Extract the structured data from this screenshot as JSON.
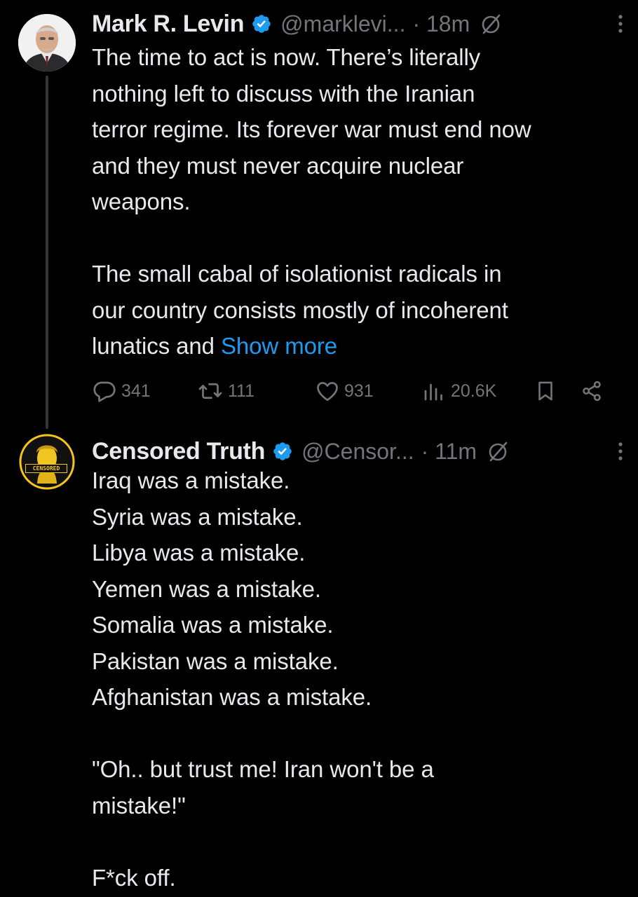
{
  "tweets": [
    {
      "name": "Mark R. Levin",
      "handle": "@marklevi...",
      "time": "· 18m",
      "lines": [
        "The time to act is now. There’s literally",
        "nothing left to discuss with the Iranian",
        "terror regime. Its forever war must end now",
        "and they must never acquire nuclear",
        "weapons.",
        "",
        "The small cabal of isolationist radicals in",
        "our country consists mostly of incoherent",
        "lunatics and "
      ],
      "show_more": "Show more",
      "stats": {
        "replies": "341",
        "reposts": "111",
        "likes": "931",
        "views": "20.6K"
      }
    },
    {
      "name": "Censored Truth",
      "handle": "@Censor...",
      "time": "· 11m",
      "avatar_text": "CENSORED",
      "lines": [
        "Iraq was a mistake.",
        "Syria was a mistake.",
        "Libya was a mistake.",
        "Yemen was a mistake.",
        "Somalia was a mistake.",
        "Pakistan was a mistake.",
        "Afghanistan was a mistake.",
        "",
        "\"Oh.. but trust me! Iran won't be a",
        "mistake!\"",
        "",
        "F*ck off."
      ]
    }
  ],
  "colors": {
    "accent": "#1d9bf0",
    "muted": "#71767b",
    "text": "#e7e9ea",
    "background": "#000000",
    "avatar_ring": "#f5c518"
  },
  "icons": [
    "verified-badge-icon",
    "grok-icon",
    "more-vertical-icon",
    "reply-icon",
    "repost-icon",
    "like-icon",
    "views-icon",
    "bookmark-icon",
    "share-icon"
  ]
}
